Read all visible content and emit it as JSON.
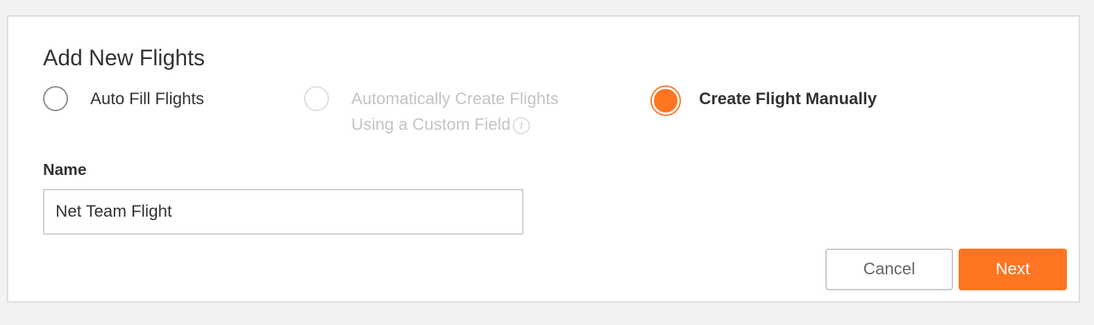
{
  "dialog": {
    "title": "Add New Flights"
  },
  "options": {
    "auto_fill": {
      "label": "Auto Fill Flights",
      "selected": false,
      "disabled": false
    },
    "custom_field": {
      "label_line1": "Automatically Create Flights",
      "label_line2": "Using a Custom Field",
      "info_icon": "info-icon",
      "info_glyph": "i",
      "selected": false,
      "disabled": true
    },
    "manual": {
      "label": "Create Flight Manually",
      "selected": true,
      "disabled": false
    }
  },
  "name_field": {
    "label": "Name",
    "value": "Net Team Flight"
  },
  "buttons": {
    "cancel_label": "Cancel",
    "next_label": "Next"
  },
  "colors": {
    "accent": "#ff7521",
    "background": "#f2f2f2",
    "panel": "#ffffff",
    "text": "#333333",
    "disabled_text": "#c4c4c4"
  }
}
